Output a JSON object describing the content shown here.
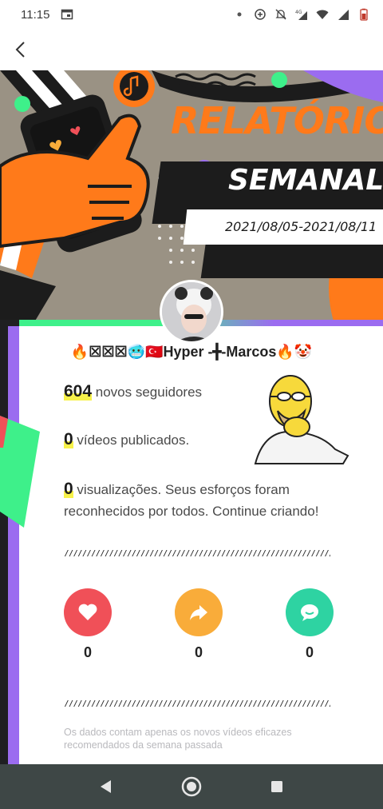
{
  "status_bar": {
    "time": "11:15",
    "icons": [
      "calendar-icon",
      "dot-icon",
      "add-circle-icon",
      "mute-icon",
      "4g-signal-icon",
      "wifi-icon",
      "signal-icon",
      "battery-icon"
    ]
  },
  "app_bar": {
    "back_icon": "chevron-left-icon"
  },
  "hero": {
    "title_line1": "RELATÓRIO",
    "title_line2": "SEMANAL",
    "date_range": "2021/08/05-2021/08/11"
  },
  "profile": {
    "username": "🔥☒☒☒🥶🇹🇷Hyper -╋-Marcos🔥🤡"
  },
  "stats": {
    "followers_num": "604",
    "followers_label": " novos seguidores",
    "videos_num": "0",
    "videos_label": " vídeos publicados.",
    "views_num": "0",
    "views_label": " visualizações.  Seus esforços foram",
    "views_label2": "reconhecidos por todos. Continue criando!"
  },
  "divider": "////////////////////////////////////////////////////////////////////////////////////////////////",
  "actions": {
    "likes_count": "0",
    "shares_count": "0",
    "comments_count": "0"
  },
  "footnote": "Os dados contam apenas os novos vídeos eficazes recomendados da semana passada",
  "colors": {
    "accent_orange": "#ff7a1a",
    "like_red": "#f05058",
    "share_orange": "#f9ac3a",
    "comment_green": "#2ed3a2",
    "highlight_yellow": "#f7f24a"
  }
}
